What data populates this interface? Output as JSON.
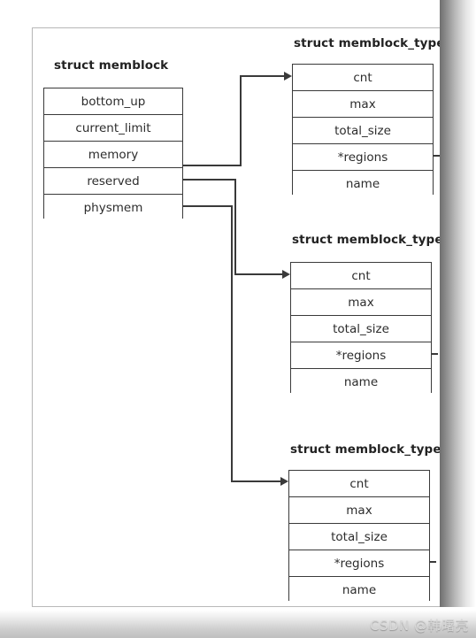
{
  "diagram": {
    "left_struct": {
      "title": "struct memblock",
      "fields": [
        "bottom_up",
        "current_limit",
        "memory",
        "reserved",
        "physmem"
      ]
    },
    "right_structs": [
      {
        "title": "struct memblock_type",
        "fields": [
          "cnt",
          "max",
          "total_size",
          "*regions",
          "name"
        ]
      },
      {
        "title": "struct memblock_type",
        "fields": [
          "cnt",
          "max",
          "total_size",
          "*regions",
          "name"
        ]
      },
      {
        "title": "struct memblock_type",
        "fields": [
          "cnt",
          "max",
          "total_size",
          "*regions",
          "name"
        ]
      }
    ],
    "connections": [
      {
        "from": "memory",
        "to": "struct memblock_type #1"
      },
      {
        "from": "reserved",
        "to": "struct memblock_type #2"
      },
      {
        "from": "physmem",
        "to": "struct memblock_type #3"
      }
    ],
    "colors": {
      "border": "#3a3a3a",
      "text": "#2c2c2c",
      "title": "#222222",
      "background": "#ffffff"
    }
  },
  "watermark": {
    "text": "CSDN @韩曙亮"
  }
}
